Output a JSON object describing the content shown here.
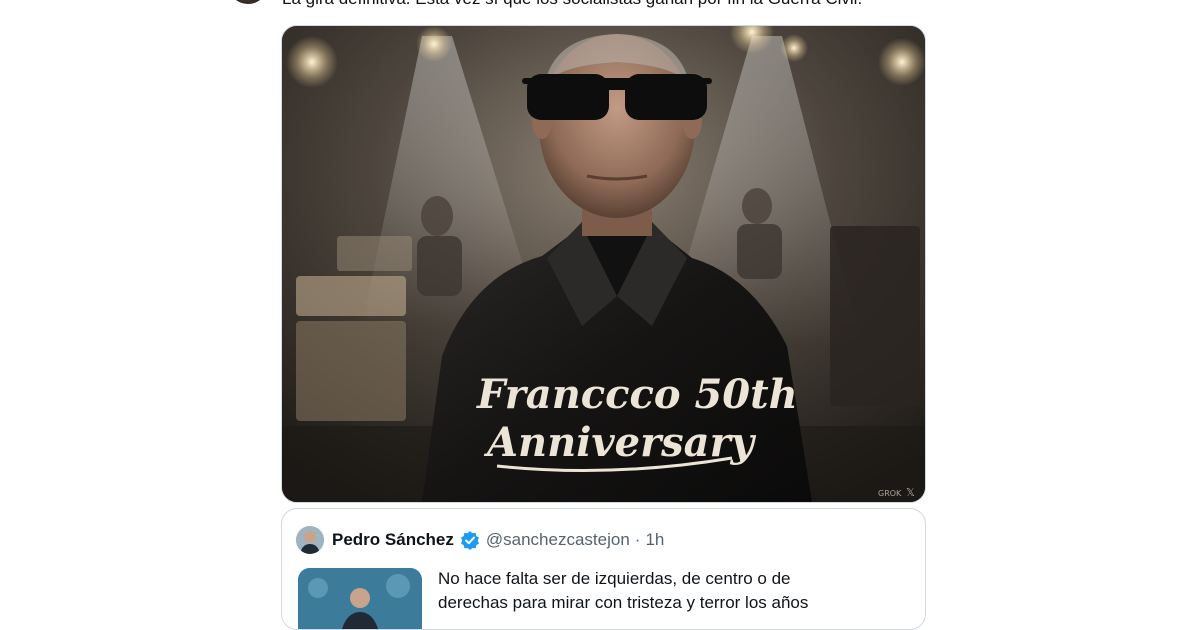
{
  "top_tweet": {
    "text_clipped": "La gira definitiva. Esta vez sí que los socialistas ganan por fin la Guerra Civil."
  },
  "media": {
    "overlay_line1": "Franccco 50th",
    "overlay_line2": "Anniversary",
    "watermark": "GROK"
  },
  "quote": {
    "name": "Pedro Sánchez",
    "handle": "@sanchezcastejon",
    "separator": "·",
    "time": "1h",
    "text_line1": "No hace falta ser de izquierdas, de centro o de",
    "text_line2": "derechas para mirar con tristeza y terror los años"
  },
  "colors": {
    "verified": "#1d9bf0",
    "border": "#cfd9de",
    "secondary_text": "#536471"
  }
}
